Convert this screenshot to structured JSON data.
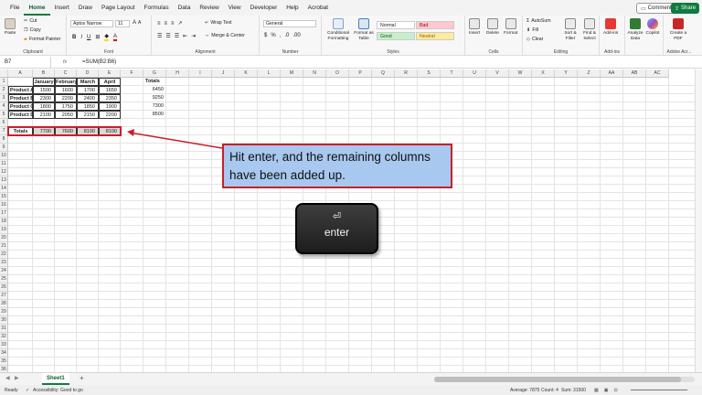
{
  "menu": {
    "items": [
      "File",
      "Home",
      "Insert",
      "Draw",
      "Page Layout",
      "Formulas",
      "Data",
      "Review",
      "View",
      "Developer",
      "Help",
      "Acrobat"
    ],
    "comments": "Comments",
    "share": "Share"
  },
  "ribbon": {
    "paste": "Paste",
    "cut": "Cut",
    "copy": "Copy",
    "format_painter": "Format Painter",
    "clipboard": "Clipboard",
    "font_name": "Aptos Narrow",
    "font_size": "11",
    "font": "Font",
    "wrap_text": "Wrap Text",
    "merge_center": "Merge & Center",
    "alignment": "Alignment",
    "number_format": "General",
    "number": "Number",
    "conditional_formatting": "Conditional Formatting",
    "format_as_table": "Format as Table",
    "style_normal": "Normal",
    "style_bad": "Bad",
    "style_good": "Good",
    "style_neutral": "Neutral",
    "styles": "Styles",
    "insert": "Insert",
    "delete": "Delete",
    "format": "Format",
    "cells": "Cells",
    "autosum": "AutoSum",
    "fill": "Fill",
    "clear": "Clear",
    "sort_filter": "Sort & Filter",
    "find_select": "Find & Select",
    "editing": "Editing",
    "addins": "Add-ins",
    "addins_group": "Add-ins",
    "analyze_data": "Analyze Data",
    "copilot": "Copilot",
    "create_pdf": "Create a PDF",
    "adobe": "Adobe Acr..."
  },
  "formula_bar": {
    "name_box": "B7",
    "fx": "fx",
    "formula": "=SUM(B2:B6)"
  },
  "columns": [
    "A",
    "B",
    "C",
    "D",
    "E",
    "F",
    "G",
    "H",
    "I",
    "J",
    "K",
    "L",
    "M",
    "N",
    "O",
    "P",
    "Q",
    "R",
    "S",
    "T",
    "U",
    "V",
    "W",
    "X",
    "Y",
    "Z",
    "AA",
    "AB",
    "AC"
  ],
  "row_numbers": [
    "1",
    "2",
    "3",
    "4",
    "5",
    "6",
    "7",
    "8",
    "9",
    "10",
    "11",
    "12",
    "13",
    "14",
    "15",
    "16",
    "17",
    "18",
    "19",
    "20",
    "21",
    "22",
    "23",
    "24",
    "25",
    "26",
    "27",
    "28",
    "29",
    "30",
    "31",
    "32",
    "33",
    "34",
    "35",
    "36"
  ],
  "sheet": {
    "headers": [
      "January",
      "February",
      "March",
      "April"
    ],
    "products": [
      {
        "name": "Product A",
        "values": [
          "1500",
          "1600",
          "1700",
          "1650"
        ]
      },
      {
        "name": "Product B",
        "values": [
          "2300",
          "2200",
          "2400",
          "2350"
        ]
      },
      {
        "name": "Product C",
        "values": [
          "1800",
          "1750",
          "1850",
          "1900"
        ]
      },
      {
        "name": "Product D",
        "values": [
          "2100",
          "2050",
          "2150",
          "2200"
        ]
      }
    ],
    "totals_label": "Totals",
    "totals": [
      "7700",
      "7600",
      "8100",
      "8100"
    ],
    "g_header": "Totals",
    "g_values": [
      "6450",
      "9250",
      "7300",
      "8500"
    ]
  },
  "callout": {
    "text": "Hit enter, and the remaining columns have been added up."
  },
  "key": {
    "arrow": "⏎",
    "label": "enter"
  },
  "tabs": {
    "sheet1": "Sheet1",
    "add": "+"
  },
  "status": {
    "ready": "Ready",
    "accessibility": "Accessibility: Good to go",
    "average": "Average: 7875",
    "count": "Count: 4",
    "sum": "Sum: 31500"
  },
  "colors": {
    "accent": "#0f7b3f",
    "callout_fill": "#a8c8ef",
    "callout_border": "#c8202a"
  }
}
